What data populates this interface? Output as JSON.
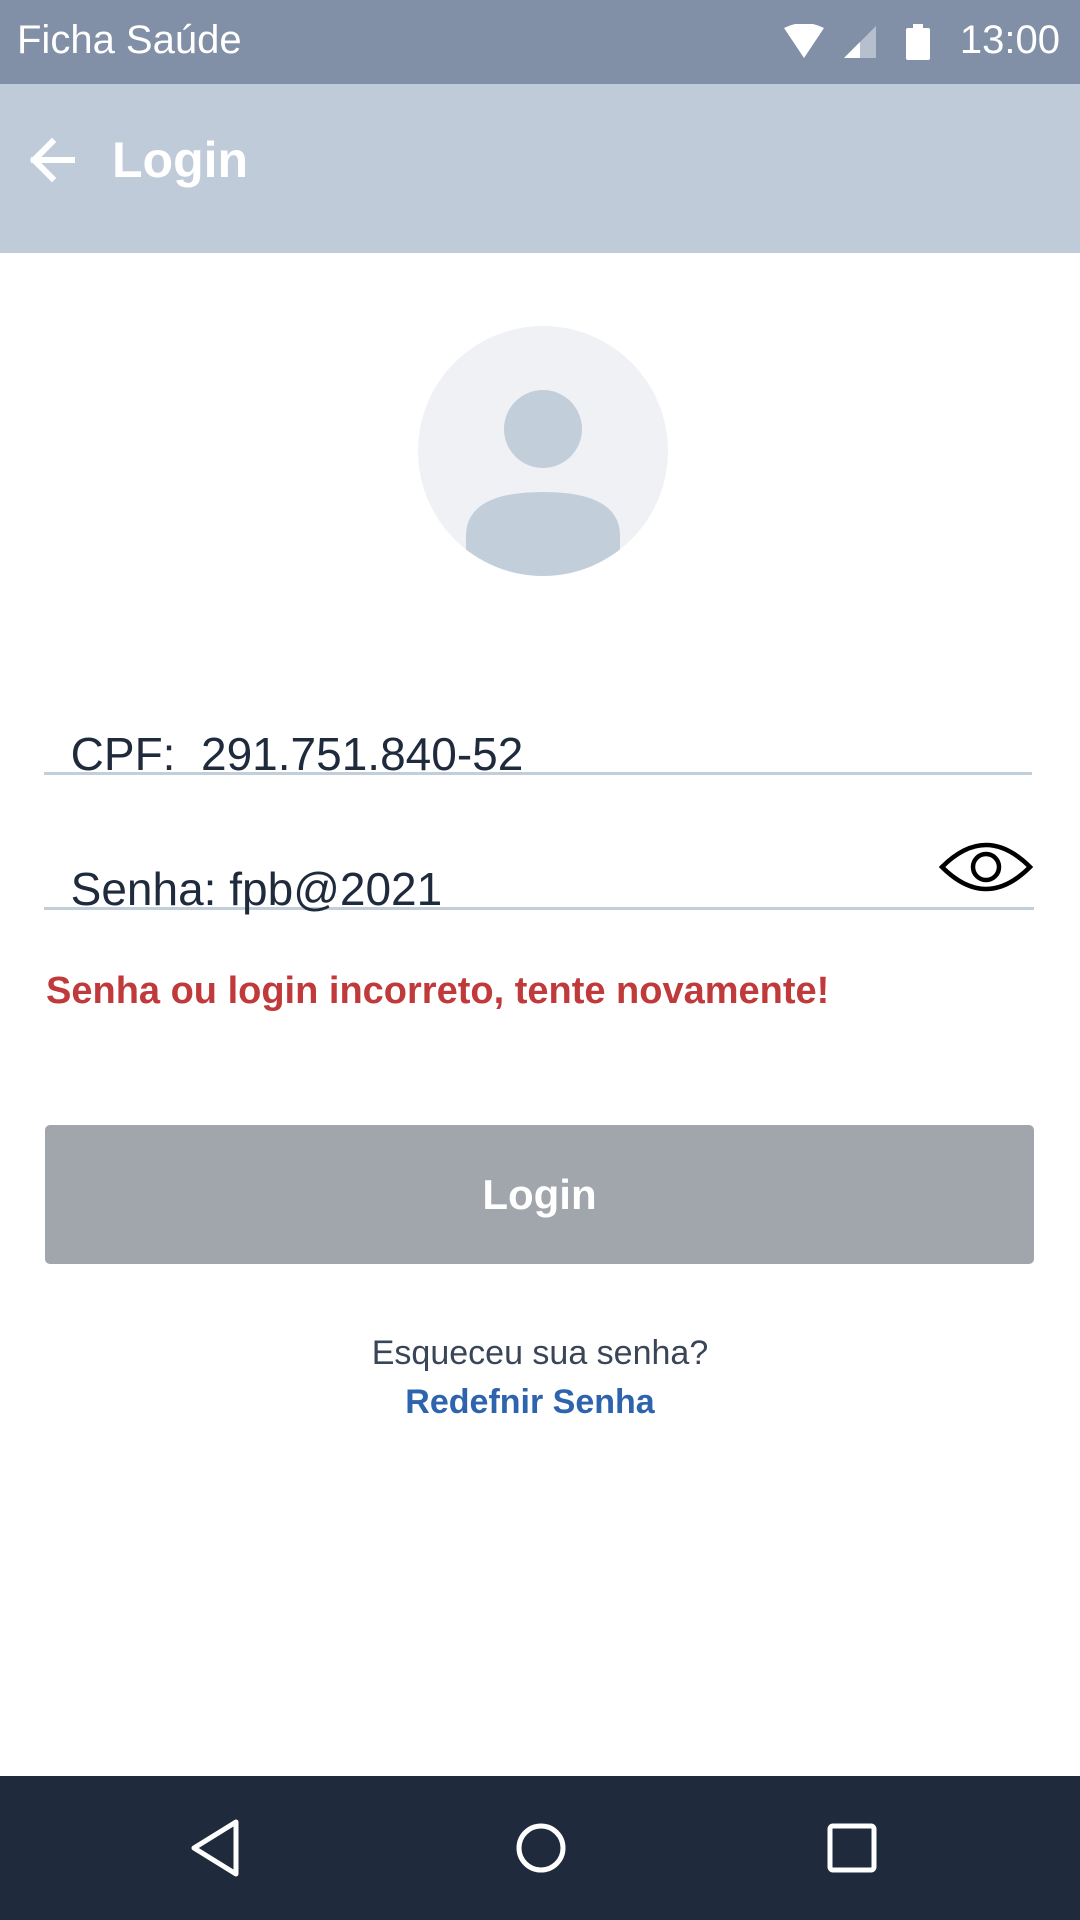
{
  "status_bar": {
    "app_name": "Ficha Saúde",
    "time": "13:00",
    "icons": [
      "wifi-icon",
      "signal-icon",
      "battery-icon"
    ]
  },
  "app_bar": {
    "title": "Login",
    "back_icon": "arrow-left-icon"
  },
  "avatar": {
    "icon": "user-placeholder-icon"
  },
  "form": {
    "cpf_label": "CPF:",
    "cpf_value": "291.751.840-52",
    "password_label": "Senha:",
    "password_value": "fpb@2021",
    "toggle_visibility_icon": "eye-icon",
    "error_message": "Senha ou login incorreto, tente novamente!",
    "login_button": "Login"
  },
  "footer": {
    "forgot_text": "Esqueceu sua senha?",
    "reset_link": "Redefnir Senha"
  },
  "nav_bar": {
    "icons": [
      "nav-back-icon",
      "nav-home-icon",
      "nav-recents-icon"
    ]
  },
  "colors": {
    "status_bar": "#8190a6",
    "app_bar": "#c0cbd9",
    "error": "#c0393b",
    "button_disabled": "#a1a5ac",
    "link": "#2e63ad",
    "nav_bar": "#1f2b3d"
  }
}
